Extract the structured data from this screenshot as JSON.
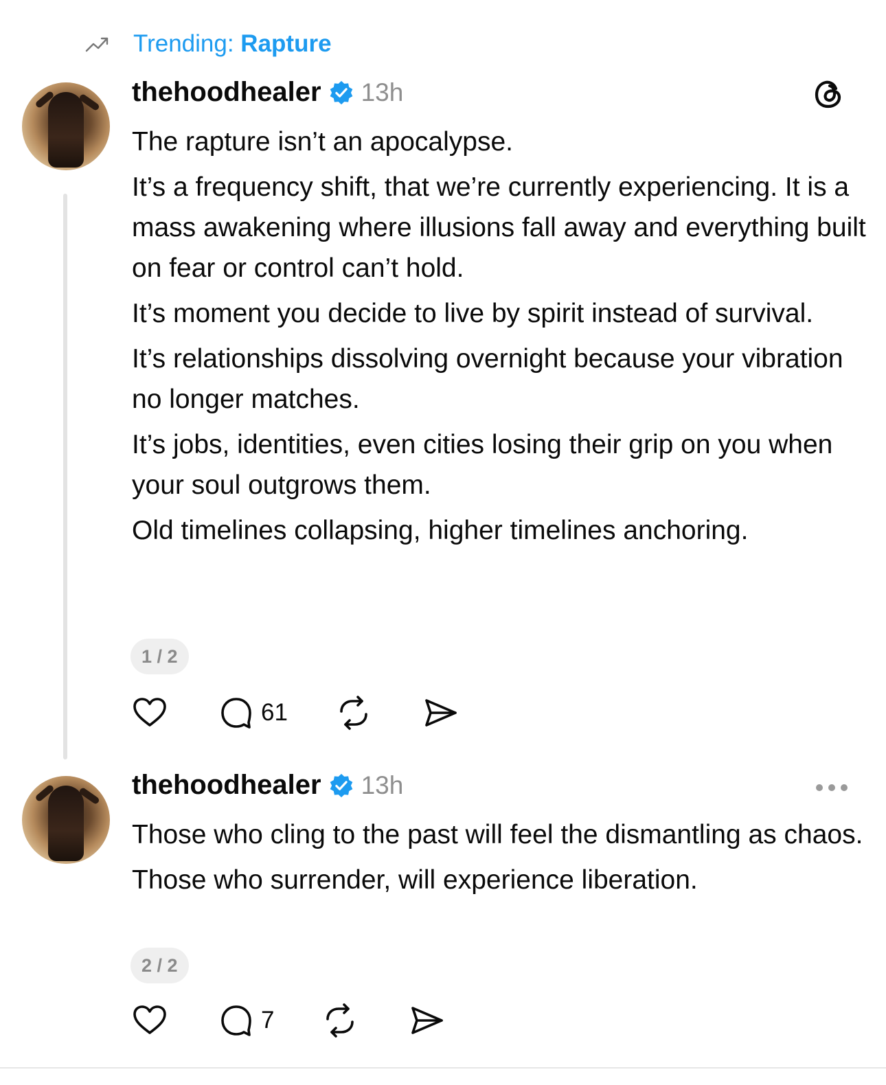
{
  "trending": {
    "label": "Trending:",
    "topic": "Rapture",
    "icon": "trending-up-icon"
  },
  "colors": {
    "accent": "#1d9bf0",
    "verified": "#1d9bf0",
    "muted": "#8e8e8e"
  },
  "posts": [
    {
      "username": "thehoodhealer",
      "time": "13h",
      "paragraphs": [
        "The rapture isn’t an apocalypse.",
        "It’s a frequency shift, that we’re currently experiencing. It is a mass awakening where illusions fall away and everything built on fear or control can’t hold.",
        "It’s moment you decide to live by spirit instead of survival.",
        "It’s relationships dissolving overnight because your vibration no longer matches.",
        "It’s jobs, identities, even cities losing their grip on you when your soul outgrows them.",
        "Old timelines collapsing, higher timelines anchoring."
      ],
      "counter": "1 / 2",
      "replies": "61"
    },
    {
      "username": "thehoodhealer",
      "time": "13h",
      "paragraphs": [
        "Those who cling to the past will feel the dismantling as chaos.",
        "Those who surrender, will experience liberation."
      ],
      "counter": "2 / 2",
      "replies": "7"
    }
  ]
}
